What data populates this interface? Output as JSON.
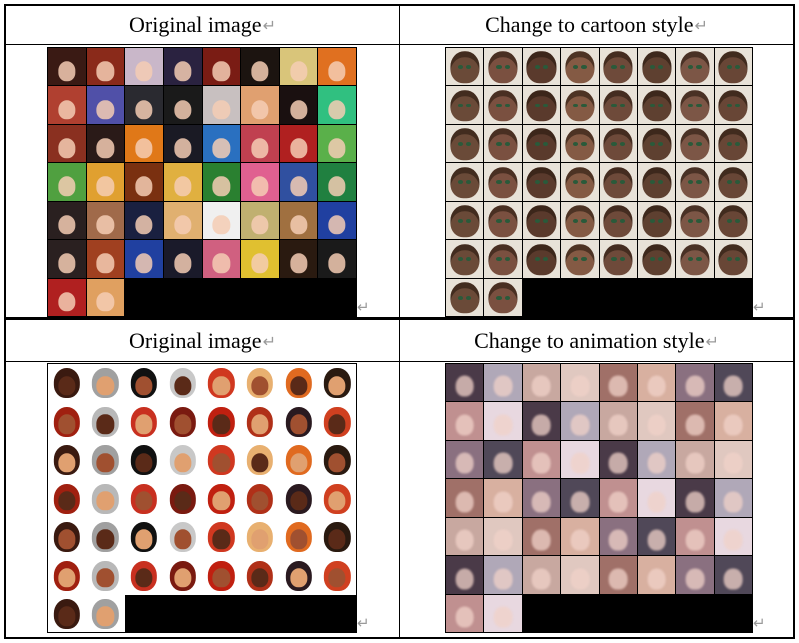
{
  "table": {
    "row1": {
      "left_header": "Original image",
      "right_header": "Change to cartoon style"
    },
    "row2": {
      "left_header": "Original image",
      "right_header": "Change to animation style"
    },
    "return_mark": "↵"
  },
  "image_grid": {
    "columns": 8,
    "rows": 7,
    "filled_in_last_row": 2
  },
  "colors": {
    "anime_palette": [
      "#3a1a14",
      "#8a2a1a",
      "#c9b7c9",
      "#2a2240",
      "#7a1c14",
      "#1c1410",
      "#d9c57a",
      "#e07020",
      "#b04030",
      "#5050a8",
      "#2a2a30",
      "#1a1a1a",
      "#c8c0c0",
      "#e0a070",
      "#1a1010",
      "#30c080",
      "#8a3020",
      "#2a1a18",
      "#e07818",
      "#1a1a24",
      "#2a70c0",
      "#c04050",
      "#b02020",
      "#5ab04a",
      "#50a040",
      "#e0a030",
      "#7a3010",
      "#e0b040",
      "#2a8030",
      "#e06090",
      "#3050a0",
      "#208040",
      "#2a2020",
      "#a06a4a",
      "#1a2040",
      "#e0b070",
      "#f0f0f0",
      "#c0b070",
      "#a07040",
      "#2040a0",
      "#2a2020",
      "#a04020",
      "#2040a0",
      "#1a1a2a",
      "#d06080",
      "#e0c030",
      "#2a1a10",
      "#1a1a1a",
      "#b02020",
      "#e0a060"
    ],
    "cartoon_palette": [
      "#6a4a38",
      "#7a5040",
      "#5a3a2c",
      "#845a44",
      "#6e4a3a",
      "#5e4030",
      "#7c5646",
      "#684636"
    ],
    "avatar_palette": [
      "#3a1a10",
      "#a0a0a0",
      "#111111",
      "#c8c8c8",
      "#d03820",
      "#e8b070",
      "#e06a20",
      "#2a1a10",
      "#a02010",
      "#b8b8b8",
      "#c83020",
      "#7a1a10",
      "#c02010",
      "#b03018",
      "#2a1a20",
      "#d04020"
    ],
    "animation_palette": [
      "#4a3a48",
      "#b0a8b8",
      "#c8a8a0",
      "#e0c8c0",
      "#a07068",
      "#d8b0a0",
      "#8a7080",
      "#504858",
      "#c09090",
      "#e8d8e0"
    ]
  }
}
